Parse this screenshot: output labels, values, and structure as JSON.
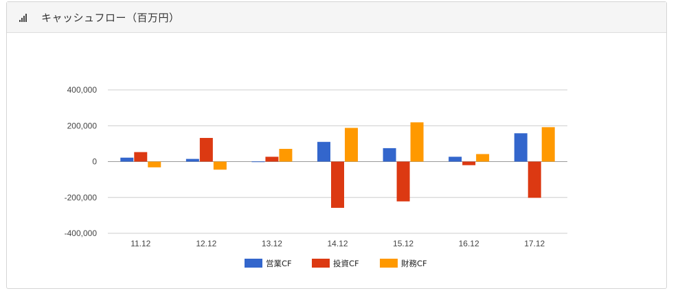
{
  "header": {
    "icon": "signal-bars-icon",
    "title": "キャッシュフロー（百万円）"
  },
  "chart_data": {
    "type": "bar",
    "categories": [
      "11.12",
      "12.12",
      "13.12",
      "14.12",
      "15.12",
      "16.12",
      "17.12"
    ],
    "series": [
      {
        "name": "営業CF",
        "color": "#3366cc",
        "values": [
          22000,
          15000,
          1000,
          110000,
          75000,
          27000,
          158000
        ]
      },
      {
        "name": "投資CF",
        "color": "#dc3912",
        "values": [
          53000,
          132000,
          27000,
          -258000,
          -222000,
          -20000,
          -202000
        ]
      },
      {
        "name": "財務CF",
        "color": "#ff9900",
        "values": [
          -32000,
          -45000,
          71000,
          188000,
          219000,
          42000,
          192000
        ]
      }
    ],
    "ylim": [
      -400000,
      400000
    ],
    "yticks": [
      400000,
      200000,
      0,
      -200000,
      -400000
    ],
    "ytick_labels": [
      "400,000",
      "200,000",
      "0",
      "-200,000",
      "-400,000"
    ],
    "grid": true,
    "legend_position": "bottom"
  }
}
